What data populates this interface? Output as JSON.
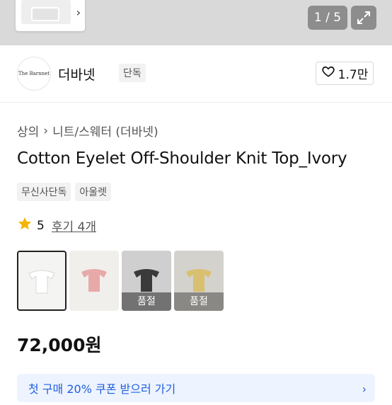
{
  "gallery": {
    "counter": "1 / 5",
    "icons": {
      "next": "chevron-right-icon",
      "expand": "expand-icon"
    }
  },
  "brand": {
    "logo_text": "The Barnnet",
    "name": "더바넷",
    "badge": "단독",
    "like_count": "1.7만"
  },
  "breadcrumb": {
    "category": "상의",
    "subcategory": "니트/스웨터 (더바넷)"
  },
  "product": {
    "title": "Cotton Eyelet Off-Shoulder Knit Top_Ivory",
    "tags": [
      "무신사단독",
      "아울렛"
    ],
    "rating": "5",
    "reviews": "후기 4개",
    "price": "72,000원"
  },
  "options": [
    {
      "color": "#f4f4f2",
      "garment": "#ffffff",
      "sold_label": ""
    },
    {
      "color": "#f1efec",
      "garment": "#e8a9a9",
      "sold_label": ""
    },
    {
      "color": "#cfcfcf",
      "garment": "#3a3a3a",
      "sold_label": "품절"
    },
    {
      "color": "#d4d2cc",
      "garment": "#d8c070",
      "sold_label": "품절"
    }
  ],
  "coupon": {
    "text": "첫 구매 20% 쿠폰 받으러 가기"
  },
  "colors": {
    "accent_star": "#f5b400",
    "coupon_text": "#1f5fe0"
  }
}
